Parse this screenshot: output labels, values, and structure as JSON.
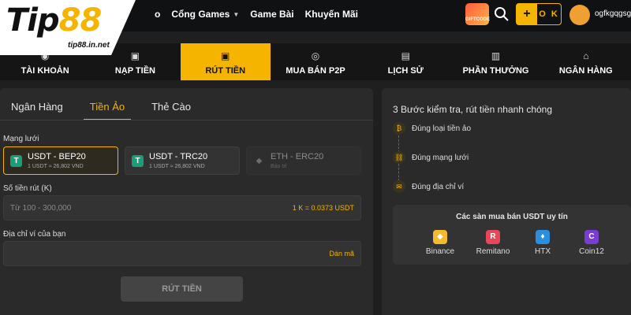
{
  "brand": {
    "logo_main_a": "Tip",
    "logo_main_b": "88",
    "logo_sub": "tip88.in.net"
  },
  "topnav": {
    "item1_suffix": "o",
    "item2": "Cổng Games",
    "item3": "Game Bài",
    "item4": "Khuyến Mãi"
  },
  "header": {
    "gift_label": "GIFTCODE",
    "ok_label": "O K",
    "username": "ogfkgqgsg"
  },
  "tabs": [
    {
      "label": "TÀI KHOẢN",
      "icon": "user-icon"
    },
    {
      "label": "NẠP TIỀN",
      "icon": "deposit-icon"
    },
    {
      "label": "RÚT TIỀN",
      "icon": "withdraw-icon"
    },
    {
      "label": "MUA BÁN P2P",
      "icon": "coins-icon"
    },
    {
      "label": "LỊCH SỬ",
      "icon": "history-icon"
    },
    {
      "label": "PHẦN THƯỞNG",
      "icon": "reward-icon"
    },
    {
      "label": "NGÂN HÀNG",
      "icon": "bank-icon"
    }
  ],
  "withdraw": {
    "subtabs": [
      "Ngân Hàng",
      "Tiền Ảo",
      "Thẻ Cào"
    ],
    "network_label": "Mạng lưới",
    "networks": [
      {
        "name": "USDT - BEP20",
        "rate": "1 USDT ≈ 26,802 VND",
        "icon": "T"
      },
      {
        "name": "USDT - TRC20",
        "rate": "1 USDT ≈ 26,802 VND",
        "icon": "T"
      },
      {
        "name": "ETH - ERC20",
        "rate": "Bảo trì",
        "icon": "◆"
      }
    ],
    "amount_label": "Số tiền rút (K)",
    "amount_placeholder": "Từ 100 - 300,000",
    "amount_rate": "1 K = 0.0373 USDT",
    "wallet_label": "Địa chỉ ví của bạn",
    "paste_label": "Dán mã",
    "submit_label": "RÚT TIỀN"
  },
  "guide": {
    "title": "3 Bước kiểm tra, rút tiền nhanh chóng",
    "steps": [
      "Đúng loại tiền ảo",
      "Đúng mạng lưới",
      "Đúng địa chỉ ví"
    ],
    "exchanges_title": "Các sàn mua bán USDT uy tín",
    "exchanges": [
      {
        "name": "Binance",
        "color": "#f3ba2f"
      },
      {
        "name": "Remitano",
        "color": "#e8475a"
      },
      {
        "name": "HTX",
        "color": "#2b8fe0"
      },
      {
        "name": "Coin12",
        "color": "#7a3cd1"
      }
    ]
  },
  "colors": {
    "accent": "#f4b400",
    "background": "#1f1f1f",
    "panel": "#2a2a2a"
  }
}
